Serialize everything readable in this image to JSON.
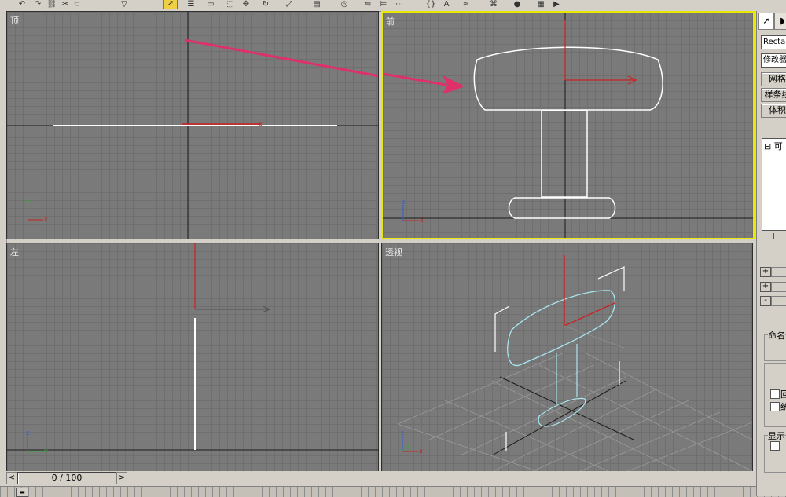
{
  "toolbar": {
    "icons": [
      "undo-icon",
      "redo-icon",
      "link-icon",
      "unlink-icon",
      "bind-icon",
      "select-filter-icon",
      "select-object-icon",
      "select-name-icon",
      "select-region-icon",
      "window-crossing-icon",
      "move-icon",
      "rotate-icon",
      "scale-icon",
      "reference-coord-icon",
      "pivot-icon",
      "mirror-icon",
      "align-icon",
      "spacing-icon",
      "named-sets-icon",
      "spelling-icon",
      "curve-editor-icon",
      "schematic-icon",
      "material-icon",
      "render-icon",
      "quick-render-icon"
    ],
    "active_index": 6
  },
  "viewports": {
    "top": {
      "label": "顶"
    },
    "front": {
      "label": "前"
    },
    "left": {
      "label": "左"
    },
    "perspective": {
      "label": "透视"
    }
  },
  "axis_letters": {
    "x": "x",
    "y": "y",
    "z": "z"
  },
  "timeline": {
    "frame_text": "0 / 100",
    "prev": "<",
    "next": ">"
  },
  "command_panel": {
    "tabs": [
      "pointer-icon",
      "modify-icon"
    ],
    "object_name": "Rectan",
    "modifier_list": "修改器",
    "buttons": [
      "网格",
      "样条线",
      "体积"
    ],
    "stack_item": "⊟ 可",
    "pin": "⊣",
    "rollouts": [
      "+",
      "+",
      "-"
    ],
    "named_group_label": "命名",
    "display_group_label": "显示",
    "checkbox_labels": [
      "回",
      "统"
    ]
  },
  "colors": {
    "viewport_bg": "#7a7a7a",
    "active_border": "#e8e800",
    "shape_white": "#ffffff",
    "shape_cyan": "#a8e6f0",
    "axis_red": "#cc2020",
    "arrow_pink": "#e0306a"
  }
}
